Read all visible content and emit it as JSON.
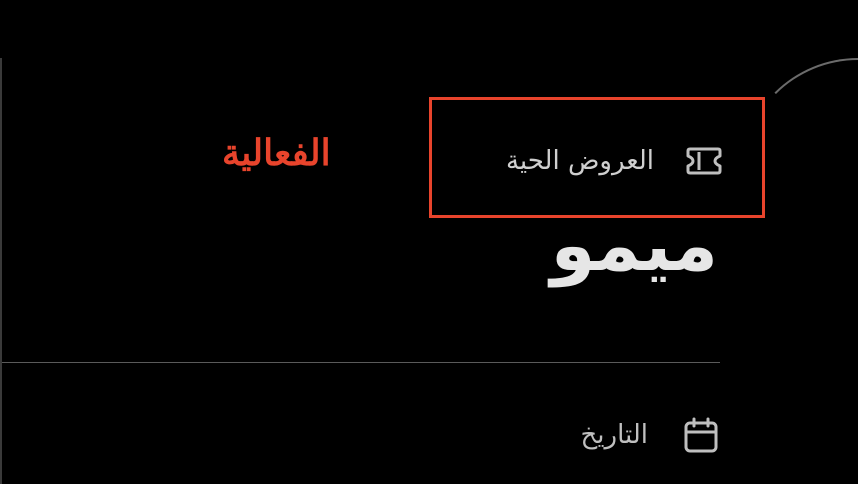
{
  "event": {
    "category": "الفعالية",
    "title": "ميمو"
  },
  "tag": {
    "label": "العروض الحية",
    "icon": "ticket-icon"
  },
  "details": {
    "date_label": "التاريخ",
    "date_icon": "calendar-icon"
  },
  "colors": {
    "accent": "#e8442c",
    "background": "#000000",
    "title_text": "#e6e6e6",
    "muted_text": "#cfcfcf"
  }
}
